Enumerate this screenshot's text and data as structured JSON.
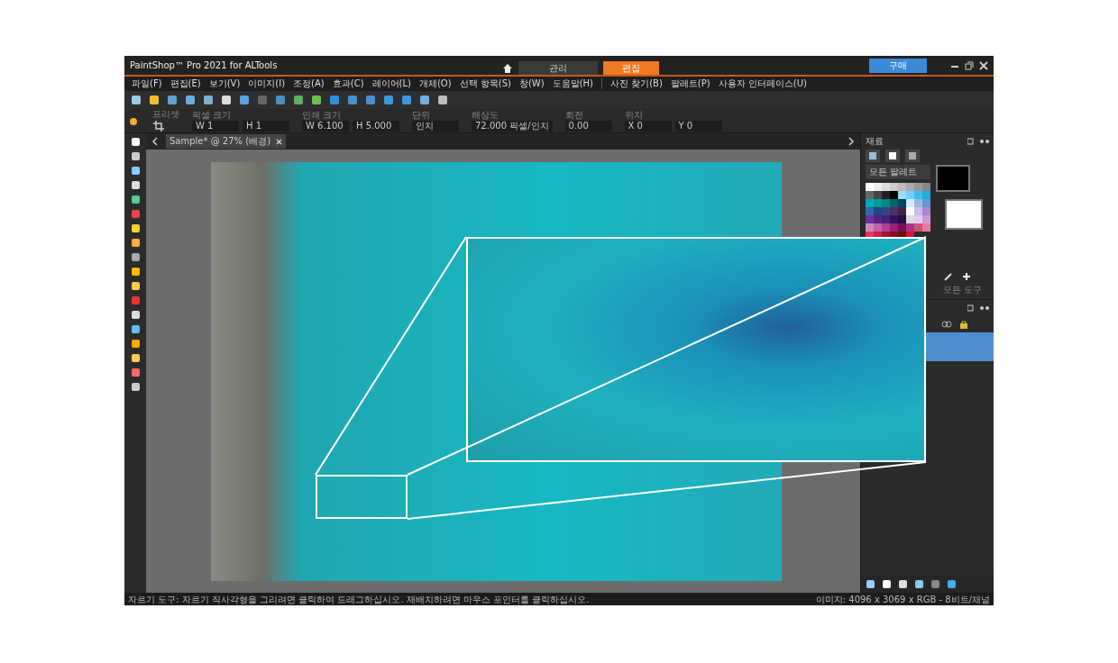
{
  "window": {
    "title": "PaintShop™ Pro 2021 for ALTools",
    "workspace_tabs": [
      {
        "label": "관리",
        "selected": false
      },
      {
        "label": "편집",
        "selected": true
      }
    ],
    "buy_button": "구매"
  },
  "menu": [
    "파일(F)",
    "편집(E)",
    "보기(V)",
    "이미지(I)",
    "조정(A)",
    "효과(C)",
    "레이어(L)",
    "개체(O)",
    "선택 항목(S)",
    "창(W)",
    "도움말(H)",
    "사진 찾기(B)",
    "팔레트(P)",
    "사용자 인터페이스(U)"
  ],
  "options_bar": [
    {
      "label": "프리셋"
    },
    {
      "label": "픽셀 크기",
      "values": [
        "W 1",
        "H 1"
      ]
    },
    {
      "label": "인쇄 크기",
      "values": [
        "W 6.100",
        "H 5.000"
      ]
    },
    {
      "label": "단위",
      "values": [
        "인치"
      ]
    },
    {
      "label": "해상도",
      "values": [
        "72.000 픽셀/인치"
      ]
    },
    {
      "label": "회전",
      "values": [
        "0.00"
      ]
    },
    {
      "label": "위치",
      "values": [
        "X 0",
        "Y 0"
      ]
    }
  ],
  "document_tab": {
    "title": "Sample* @ 27% (배경)"
  },
  "materials_panel": {
    "title": "재료",
    "palette_dropdown": "모든 팔레트",
    "tool_label": "모든 도구"
  },
  "layers_panel": {
    "rows": [
      {
        "selected": true
      }
    ]
  },
  "status_bar": {
    "hint": "자르기 도구: 자르기 직사각형을 그리려면 클릭하여 드래그하십시오. 재배치하려면 마우스 포인터를 클릭하십시오.",
    "image_info": "이미지: 4096 x 3069 x RGB - 8비트/채널"
  }
}
